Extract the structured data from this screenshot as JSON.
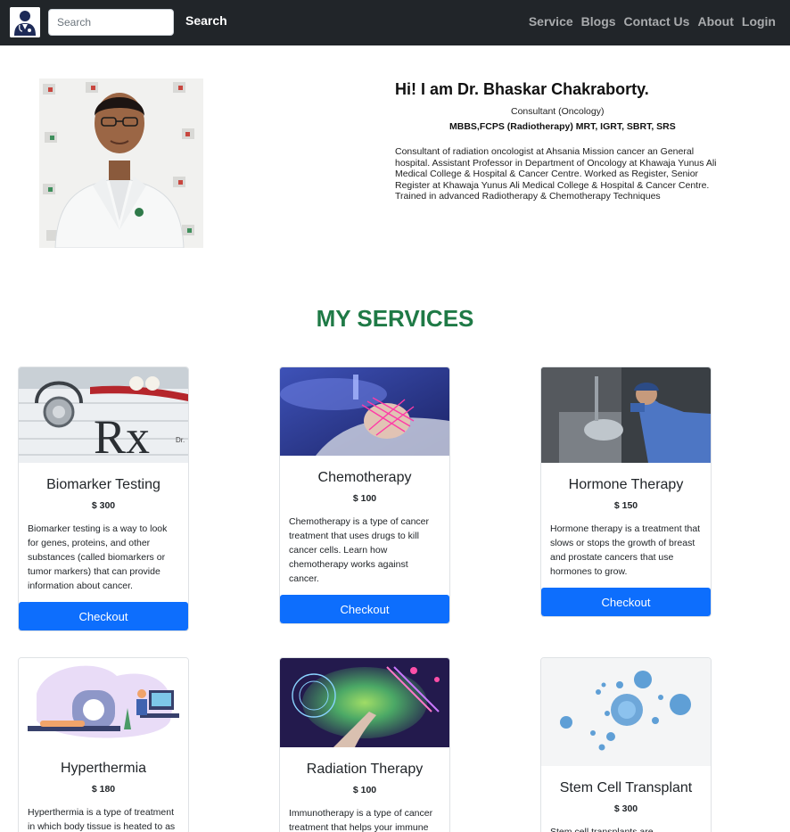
{
  "navbar": {
    "search_placeholder": "Search",
    "search_label": "Search",
    "links": [
      "Service",
      "Blogs",
      "Contact Us",
      "About",
      "Login"
    ]
  },
  "hero": {
    "title": "Hi! I am Dr. Bhaskar Chakraborty.",
    "role": "Consultant (Oncology)",
    "degrees": "MBBS,FCPS (Radiotherapy) MRT, IGRT, SBRT, SRS",
    "bio": "Consultant of radiation oncologist at Ahsania Mission cancer an General hospital. Assistant Professor in Department of Oncology at Khawaja Yunus Ali Medical College & Hospital & Cancer Centre. Worked as Register, Senior Register at Khawaja Yunus Ali Medical College & Hospital & Cancer Centre. Trained in advanced Radiotherapy & Chemotherapy Techniques"
  },
  "services": {
    "title": "MY SERVICES",
    "checkout_label": "Checkout",
    "items": [
      {
        "name": "Biomarker Testing",
        "price": "$ 300",
        "desc": "Biomarker testing is a way to look for genes, proteins, and other substances (called biomarkers or tumor markers) that can provide information about cancer."
      },
      {
        "name": "Chemotherapy",
        "price": "$ 100",
        "desc": "Chemotherapy is a type of cancer treatment that uses drugs to kill cancer cells. Learn how chemotherapy works against cancer."
      },
      {
        "name": "Hormone Therapy",
        "price": "$ 150",
        "desc": "Hormone therapy is a treatment that slows or stops the growth of breast and prostate cancers that use hormones to grow."
      },
      {
        "name": "Hyperthermia",
        "price": "$ 180",
        "desc": "Hyperthermia is a type of treatment in which body tissue is heated to as"
      },
      {
        "name": "Radiation Therapy",
        "price": "$ 100",
        "desc": "Immunotherapy is a type of cancer treatment that helps your immune"
      },
      {
        "name": "Stem Cell Transplant",
        "price": "$ 300",
        "desc": "Stem cell transplants are"
      }
    ]
  }
}
